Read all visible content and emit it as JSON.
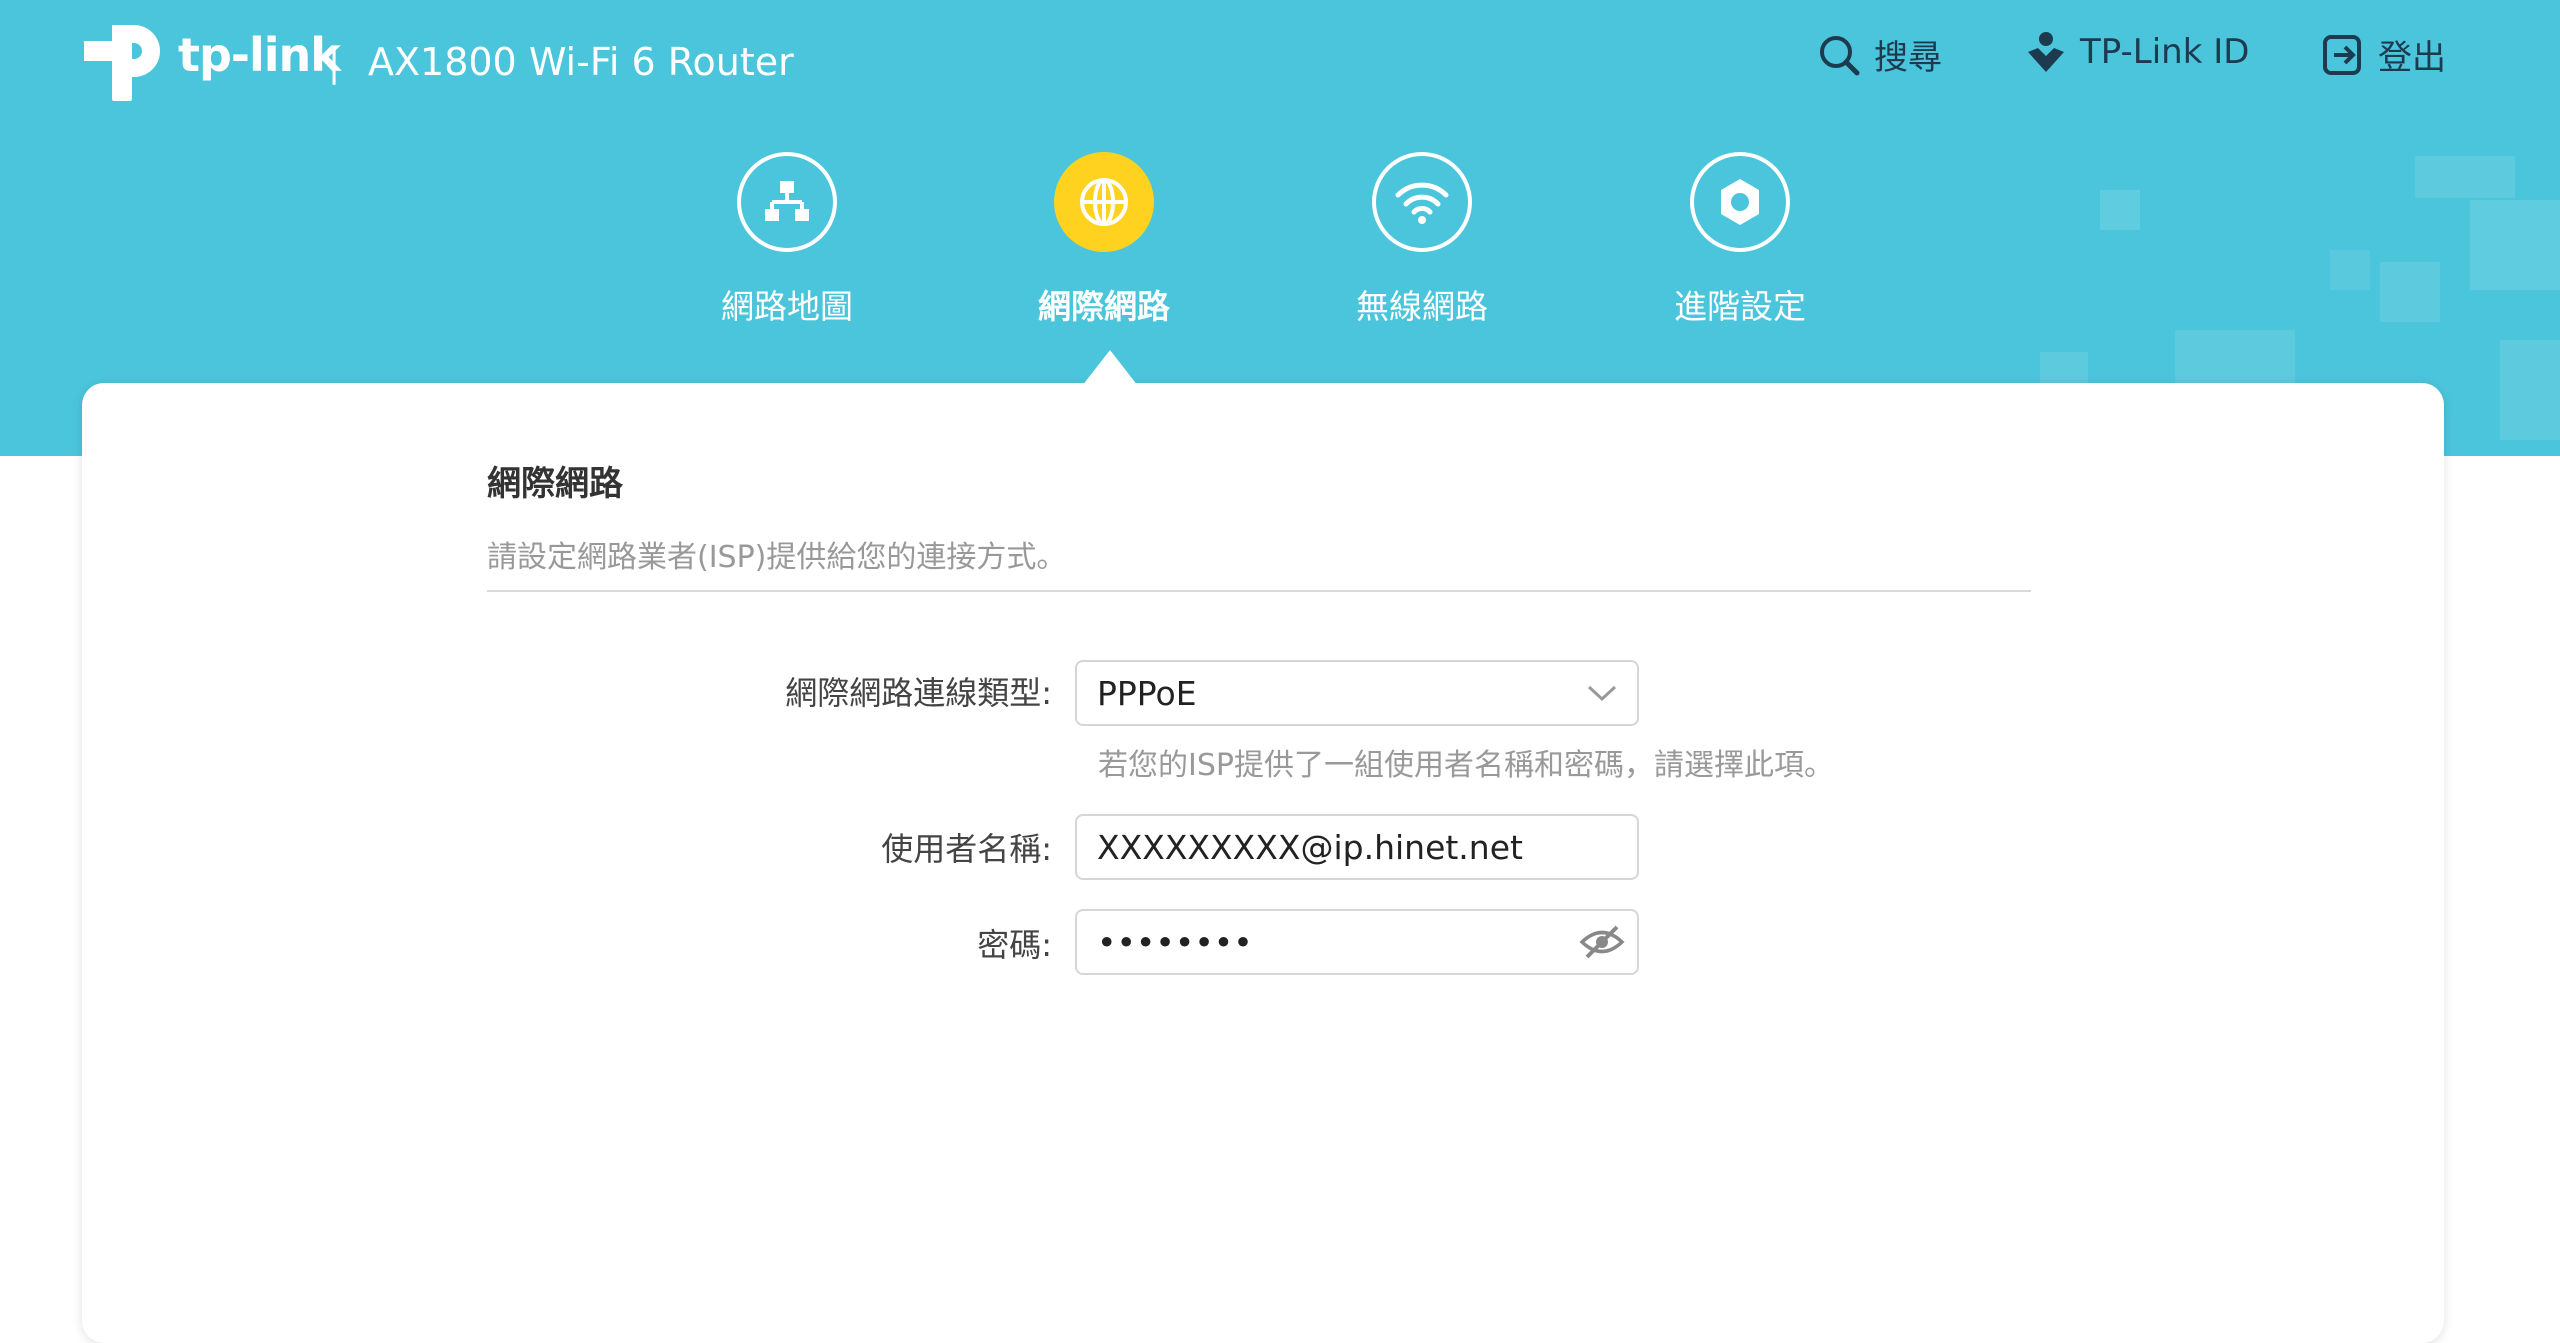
{
  "header": {
    "brand": "tp-link",
    "separator": "|",
    "product": "AX1800 Wi-Fi 6 Router",
    "search_label": "搜尋",
    "tplink_id_label": "TP-Link ID",
    "logout_label": "登出"
  },
  "nav": {
    "items": [
      {
        "label": "網路地圖",
        "icon": "network-map-icon",
        "active": false
      },
      {
        "label": "網際網路",
        "icon": "globe-icon",
        "active": true
      },
      {
        "label": "無線網路",
        "icon": "wifi-icon",
        "active": false
      },
      {
        "label": "進階設定",
        "icon": "gear-icon",
        "active": false
      }
    ]
  },
  "section": {
    "title": "網際網路",
    "description": "請設定網路業者(ISP)提供給您的連接方式。"
  },
  "form": {
    "connection_type_label": "網際網路連線類型:",
    "connection_type_value": "PPPoE",
    "connection_type_hint": "若您的ISP提供了一組使用者名稱和密碼，請選擇此項。",
    "username_label": "使用者名稱:",
    "username_value": "XXXXXXXXX@ip.hinet.net",
    "password_label": "密碼:",
    "password_value": "••••••••"
  },
  "colors": {
    "header_bg": "#4bc5db",
    "active_nav": "#ffd21f",
    "text_dark": "#1d3b4f"
  }
}
